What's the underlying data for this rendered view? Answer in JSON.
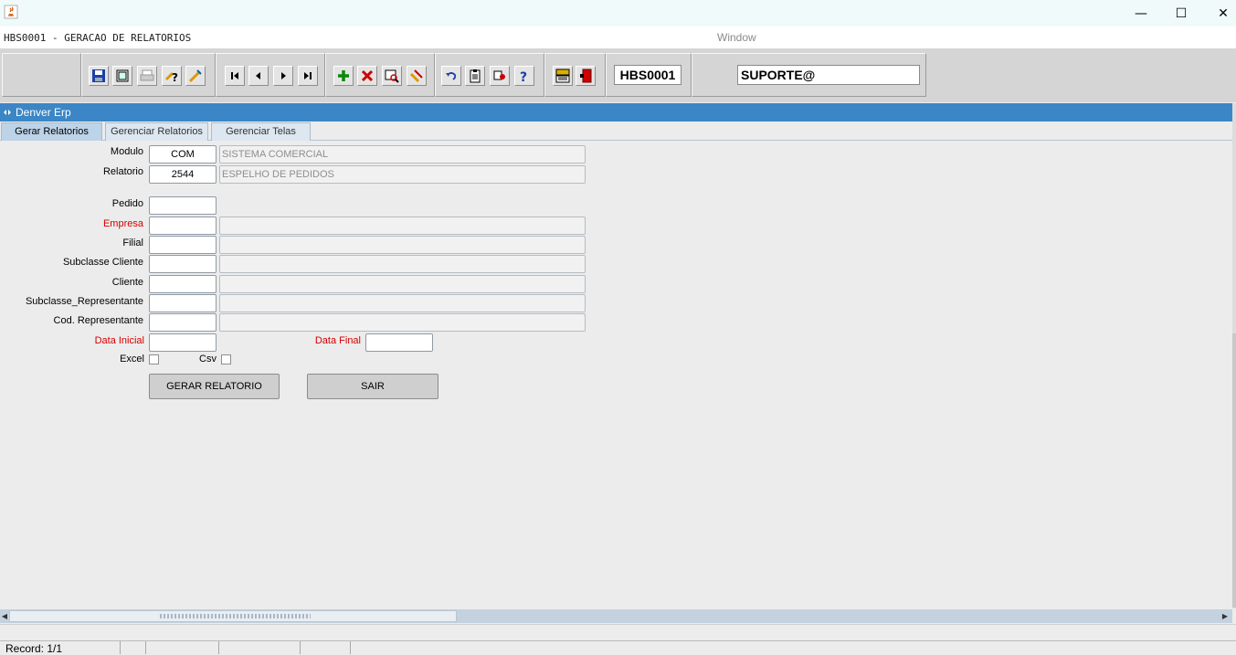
{
  "window": {
    "caption": "HBS0001 - GERACAO DE RELATORIOS",
    "menu_label": "Window",
    "controls": {
      "minimize": "—",
      "maximize": "☐",
      "close": "✕"
    }
  },
  "toolbar": {
    "form_code": "HBS0001",
    "user": "SUPORTE@",
    "buttons": [
      "save-icon",
      "window-icon",
      "print-icon",
      "help-query-icon",
      "edit-icon",
      "first-record-icon",
      "previous-record-icon",
      "next-record-icon",
      "last-record-icon",
      "insert-record-icon",
      "delete-record-icon",
      "search-record-icon",
      "clear-record-icon",
      "undo-icon",
      "clipboard-icon",
      "settings-icon",
      "help-icon",
      "menu-icon",
      "exit-icon"
    ]
  },
  "frame": {
    "title": "Denver Erp"
  },
  "tabs": [
    "Gerar Relatorios",
    "Gerenciar Relatorios",
    "Gerenciar Telas"
  ],
  "active_tab": "Gerar Relatorios",
  "form": {
    "modulo": {
      "label": "Modulo",
      "code": "COM",
      "desc": "SISTEMA COMERCIAL"
    },
    "relatorio": {
      "label": "Relatorio",
      "code": "2544",
      "desc": "ESPELHO DE PEDIDOS"
    },
    "pedido": {
      "label": "Pedido",
      "value": ""
    },
    "empresa": {
      "label": "Empresa",
      "value": "",
      "desc": ""
    },
    "filial": {
      "label": "Filial",
      "value": "",
      "desc": ""
    },
    "subclasse_cliente": {
      "label": "Subclasse Cliente",
      "value": "",
      "desc": ""
    },
    "cliente": {
      "label": "Cliente",
      "value": "",
      "desc": ""
    },
    "subclasse_representante": {
      "label": "Subclasse_Representante",
      "value": "",
      "desc": ""
    },
    "cod_representante": {
      "label": "Cod. Representante",
      "value": "",
      "desc": ""
    },
    "data_inicial": {
      "label": "Data Inicial",
      "value": ""
    },
    "data_final": {
      "label": "Data Final",
      "value": ""
    },
    "excel": {
      "label": "Excel",
      "checked": false
    },
    "csv": {
      "label": "Csv",
      "checked": false
    },
    "gerar_button": "GERAR RELATORIO",
    "sair_button": "SAIR"
  },
  "status": {
    "record": "Record: 1/1"
  },
  "colors": {
    "frame_header": "#3b86c6",
    "required_label": "#d40000",
    "active_tab": "#bcd3e8"
  }
}
